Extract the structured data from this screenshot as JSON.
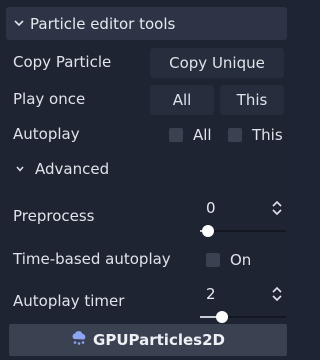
{
  "section": {
    "title": "Particle editor tools"
  },
  "copy": {
    "label": "Copy Particle",
    "unique_button": "Copy Unique"
  },
  "play_once": {
    "label": "Play once",
    "all_button": "All",
    "this_button": "This"
  },
  "autoplay": {
    "label": "Autoplay",
    "all_label": "All",
    "this_label": "This",
    "all_checked": false,
    "this_checked": false
  },
  "advanced": {
    "title": "Advanced",
    "preprocess": {
      "label": "Preprocess",
      "value": "0"
    },
    "time_based_autoplay": {
      "label": "Time-based autoplay",
      "toggle_label": "On",
      "checked": false
    },
    "autoplay_timer": {
      "label": "Autoplay timer",
      "value": "2"
    }
  },
  "footer": {
    "node_type": "GPUParticles2D",
    "icon": "gpu-particles-icon"
  },
  "colors": {
    "background": "#1e2432",
    "header": "#2d3445",
    "footer": "#3a4252",
    "icon_accent": "#8da5f3"
  }
}
